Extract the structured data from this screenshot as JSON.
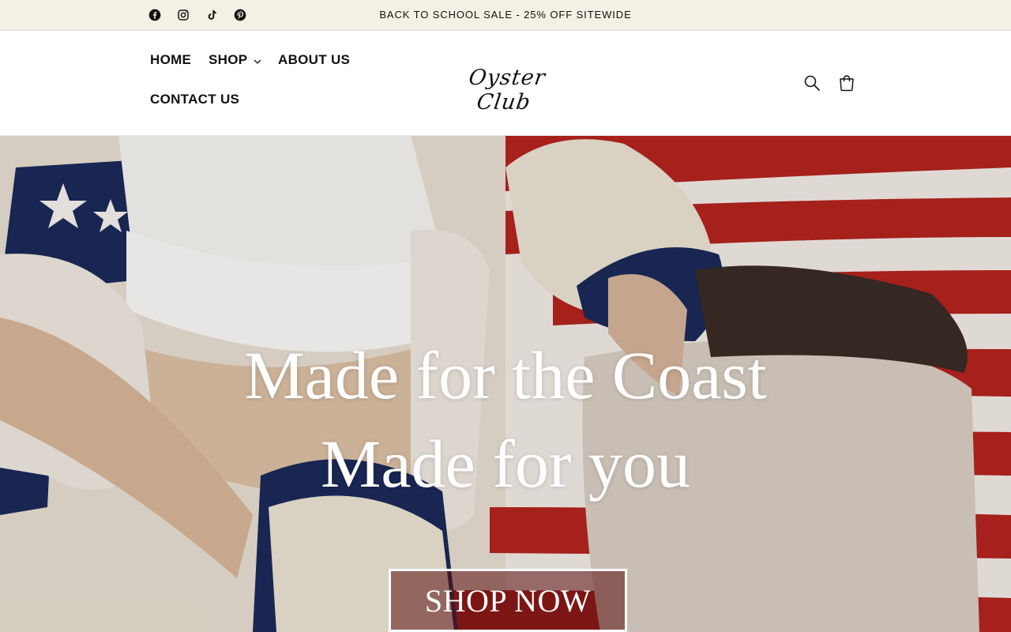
{
  "announcement": {
    "text": "BACK TO SCHOOL SALE - 25% OFF SITEWIDE"
  },
  "socials": [
    {
      "name": "facebook-icon"
    },
    {
      "name": "instagram-icon"
    },
    {
      "name": "tiktok-icon"
    },
    {
      "name": "pinterest-icon"
    }
  ],
  "nav": {
    "home": "HOME",
    "shop": "SHOP",
    "about": "ABOUT US",
    "contact": "CONTACT US"
  },
  "logo": {
    "text": "Oyster Club"
  },
  "header_icons": {
    "search": "search-icon",
    "cart": "cart-icon"
  },
  "hero": {
    "title_line1": "Made for the Coast",
    "title_line2": "Made for you",
    "cta": "SHOP NOW"
  },
  "colors": {
    "announcement_bg": "#f3f1e4",
    "text": "#121212",
    "flag_red": "#b5231f",
    "flag_blue": "#1c2a5a",
    "cap_cream": "#ece4d3"
  }
}
